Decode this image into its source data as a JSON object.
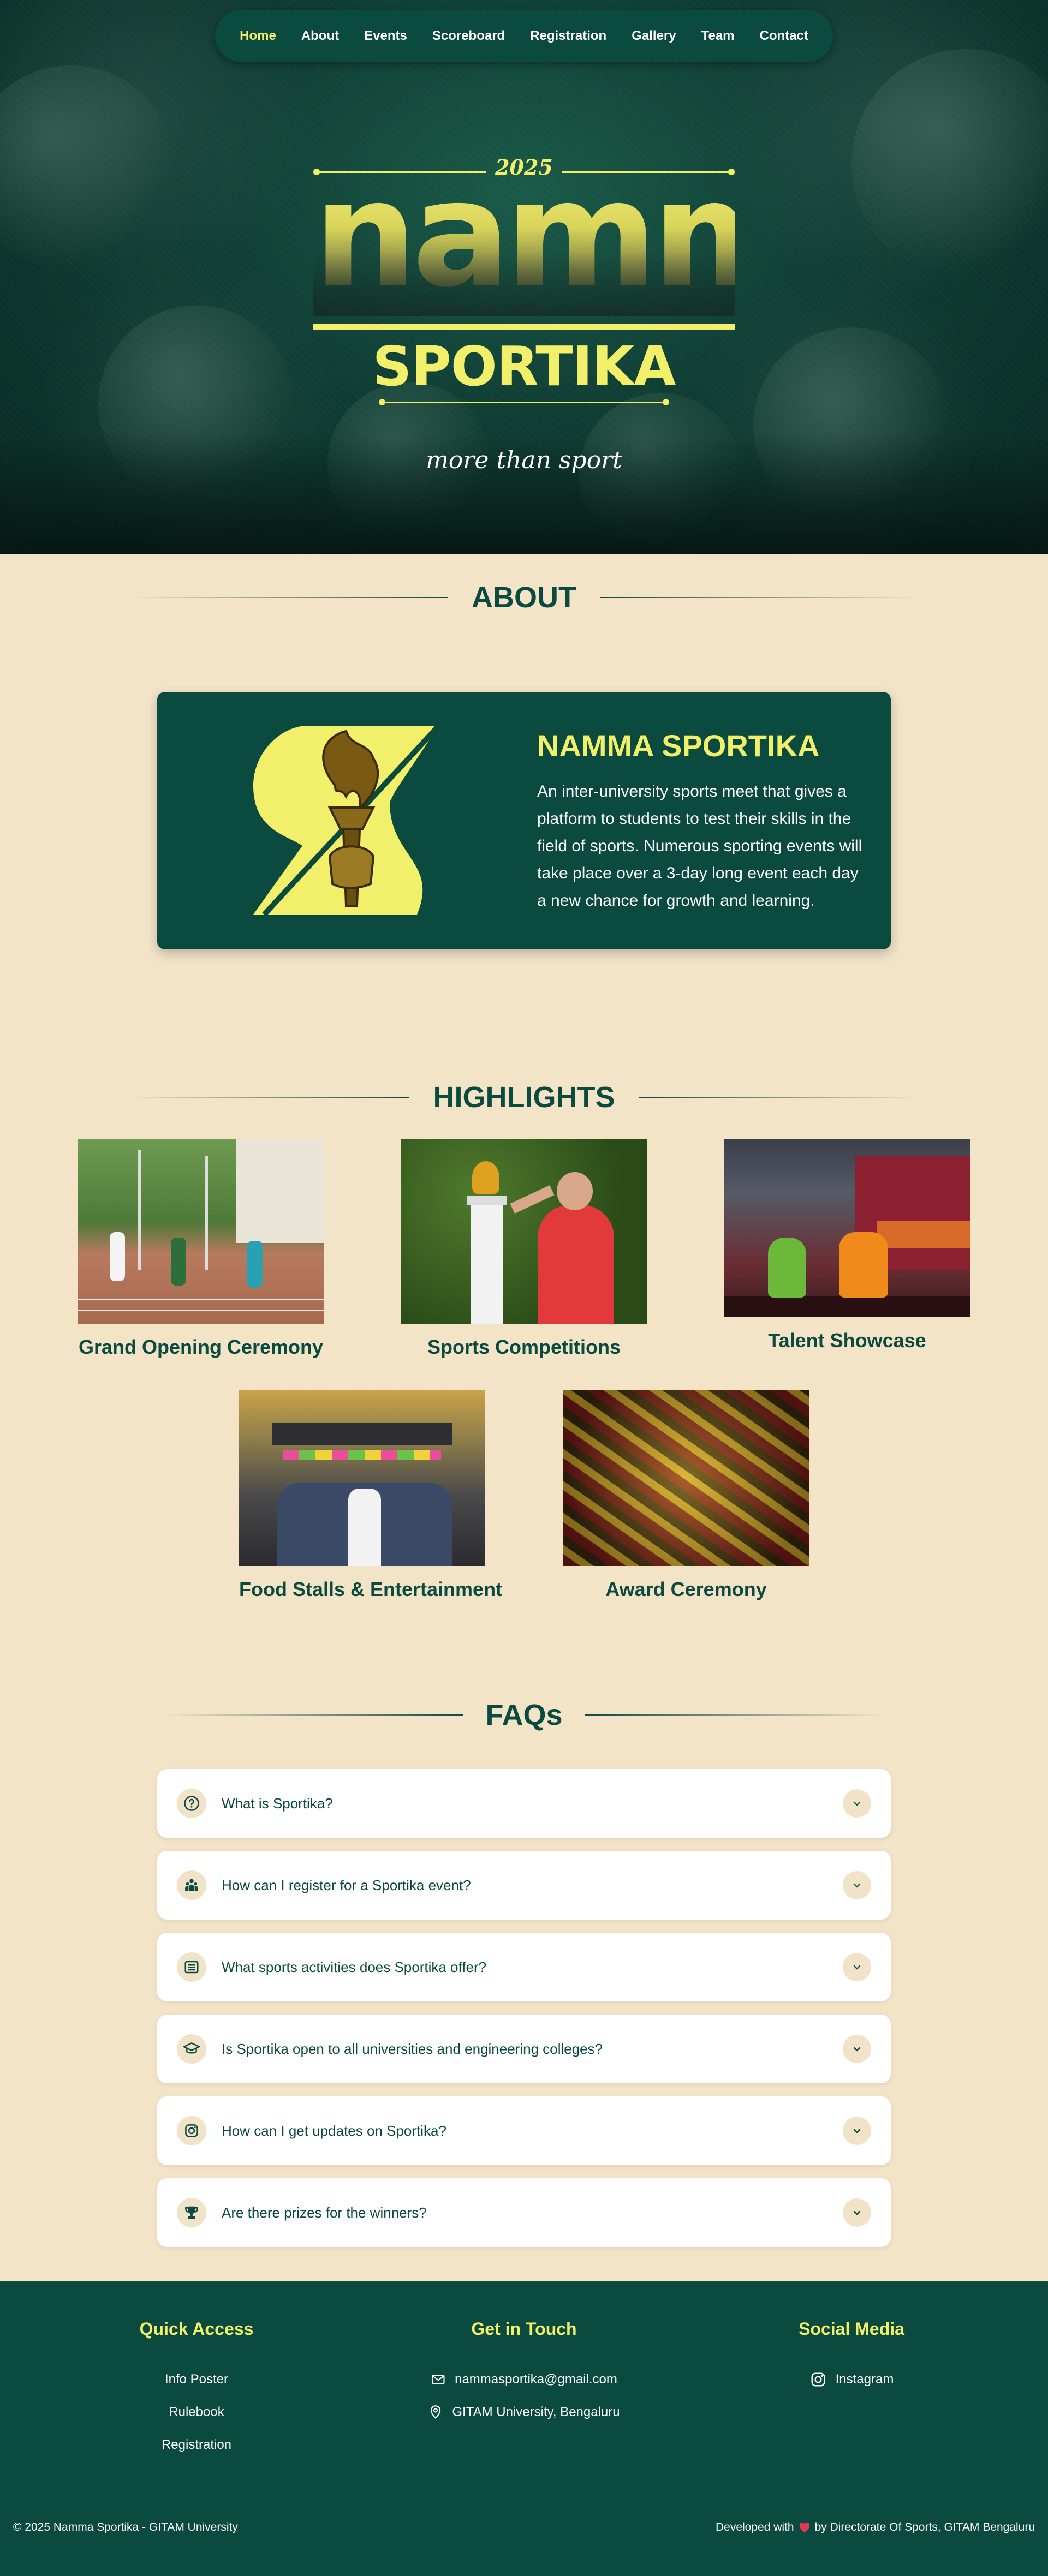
{
  "nav": {
    "items": [
      {
        "label": "Home",
        "active": true
      },
      {
        "label": "About"
      },
      {
        "label": "Events"
      },
      {
        "label": "Scoreboard"
      },
      {
        "label": "Registration"
      },
      {
        "label": "Gallery"
      },
      {
        "label": "Team"
      },
      {
        "label": "Contact"
      }
    ]
  },
  "hero": {
    "year": "2025",
    "title_top": "namma",
    "title_bottom": "SPORTIKA",
    "tagline": "more than sport"
  },
  "about": {
    "section_title": "ABOUT",
    "card_title": "NAMMA SPORTIKA",
    "text": "An inter-university sports meet that gives a platform to students to test their skills in the field of sports. Numerous sporting events will take place over a 3-day long event each day a new chance for growth and learning."
  },
  "highlights": {
    "section_title": "HIGHLIGHTS",
    "items": [
      {
        "caption": "Grand Opening Ceremony"
      },
      {
        "caption": "Sports Competitions"
      },
      {
        "caption": "Talent Showcase"
      },
      {
        "caption": "Food Stalls & Entertainment"
      },
      {
        "caption": "Award Ceremony"
      }
    ]
  },
  "faqs": {
    "section_title": "FAQs",
    "items": [
      {
        "question": "What is Sportika?",
        "icon": "question-icon"
      },
      {
        "question": "How can I register for a Sportika event?",
        "icon": "people-icon"
      },
      {
        "question": "What sports activities does Sportika offer?",
        "icon": "list-icon"
      },
      {
        "question": "Is Sportika open to all universities and engineering colleges?",
        "icon": "graduation-cap-icon"
      },
      {
        "question": "How can I get updates on Sportika?",
        "icon": "instagram-icon"
      },
      {
        "question": "Are there prizes for the winners?",
        "icon": "trophy-icon"
      }
    ]
  },
  "footer": {
    "quick_access": {
      "heading": "Quick Access",
      "links": [
        "Info Poster",
        "Rulebook",
        "Registration"
      ]
    },
    "contact": {
      "heading": "Get in Touch",
      "email": "nammasportika@gmail.com",
      "location": "GITAM University, Bengaluru"
    },
    "social": {
      "heading": "Social Media",
      "instagram": "Instagram"
    },
    "copyright": "© 2025 Namma Sportika - GITAM University",
    "credit_prefix": "Developed with",
    "credit_suffix": "by Directorate Of Sports, GITAM Bengaluru"
  },
  "colors": {
    "primary_green": "#0b4a3f",
    "accent_yellow": "#f2ef6a",
    "background_cream": "#f3e4c8",
    "heart": "#e53950"
  }
}
